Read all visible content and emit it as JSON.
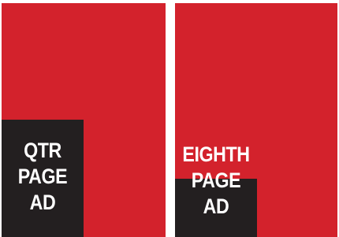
{
  "colors": {
    "page": "#d3222c",
    "ad_block": "#231f20",
    "label": "#ffffff",
    "background": "#ffffff"
  },
  "pages": [
    {
      "name": "quarter-page",
      "label_lines": [
        "QTR",
        "PAGE",
        "AD"
      ],
      "ad_fraction_of_page": 0.25
    },
    {
      "name": "eighth-page",
      "label_lines": [
        "EIGHTH",
        "PAGE",
        "AD"
      ],
      "ad_fraction_of_page": 0.125
    }
  ]
}
